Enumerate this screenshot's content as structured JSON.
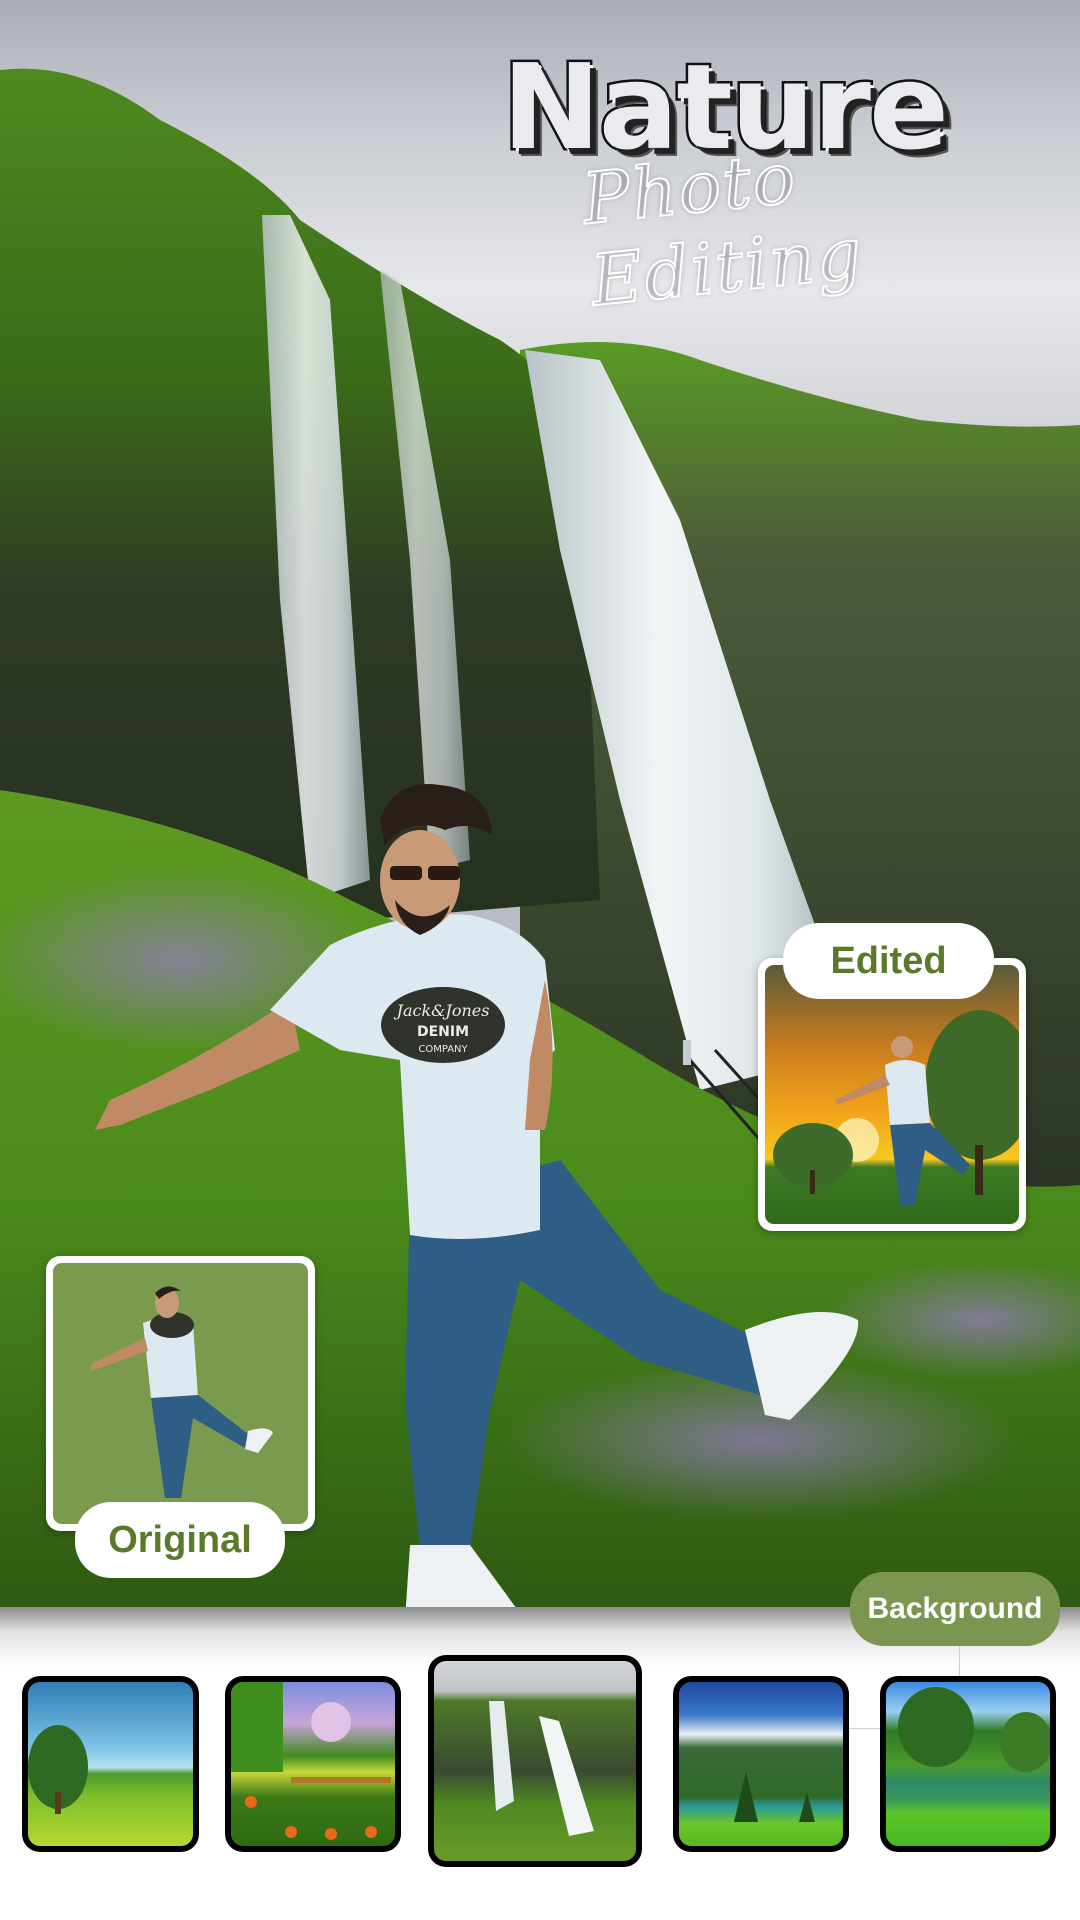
{
  "poster": {
    "title": "Nature",
    "subtitle": "Photo Editing"
  },
  "labels": {
    "edited": "Edited",
    "original": "Original",
    "background": "Background"
  },
  "shirt_print": {
    "brand": "Jack&Jones",
    "line2": "DENIM",
    "line3": "COMPANY"
  },
  "colors": {
    "accent_green": "#7b9651",
    "label_text_green": "#5a7a2a",
    "original_bg": "#7a9a4e"
  },
  "backgrounds": [
    {
      "name": "tree-meadow-sky",
      "selected": false
    },
    {
      "name": "garden-fence-flowers",
      "selected": false
    },
    {
      "name": "waterfall-cliff",
      "selected": true
    },
    {
      "name": "mountain-lake-valley",
      "selected": false
    },
    {
      "name": "pond-trees-park",
      "selected": false
    }
  ]
}
